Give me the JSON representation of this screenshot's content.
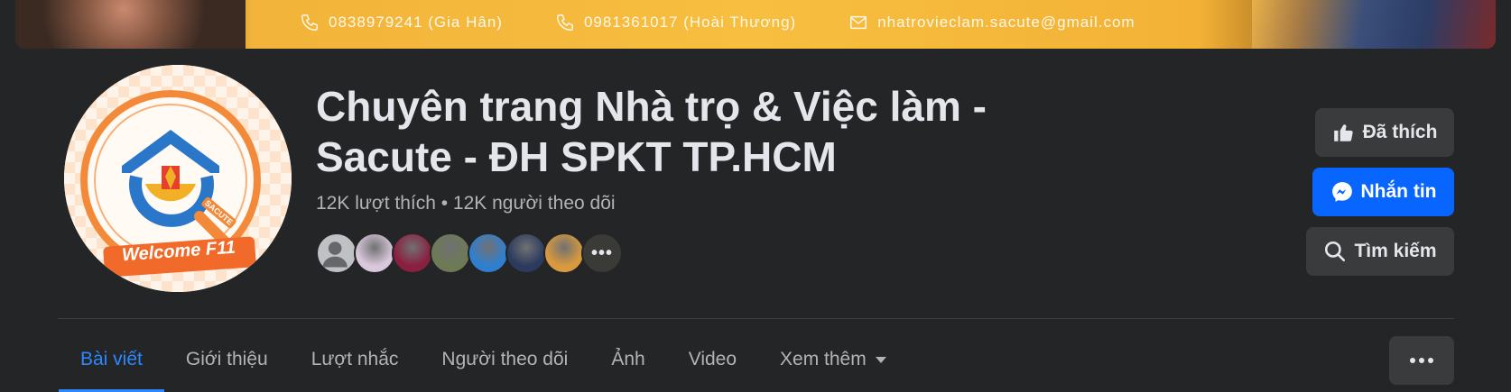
{
  "cover": {
    "contacts": [
      {
        "icon": "phone-icon",
        "text": "0838979241 (Gia Hân)"
      },
      {
        "icon": "phone-icon",
        "text": "0981361017 (Hoài Thương)"
      },
      {
        "icon": "mail-icon",
        "text": "nhatrovieclam.sacute@gmail.com"
      }
    ]
  },
  "avatar": {
    "logo_text": "Welcome F11",
    "badge_text": "SACUTE"
  },
  "page": {
    "title_line1": "Chuyên trang Nhà trọ & Việc làm -",
    "title_line2": "Sacute - ĐH SPKT TP.HCM",
    "likes": "12K lượt thích",
    "separator": " • ",
    "followers": "12K người theo dõi"
  },
  "faces": {
    "more_label": "•••",
    "colors": [
      "#bfc1c4",
      "#d9c8dc",
      "#8a1f3f",
      "#6d7a55",
      "#2f7fd1",
      "#2b3a5e",
      "#d99a3d",
      "#3a3b36"
    ]
  },
  "actions": {
    "liked": "Đã thích",
    "message": "Nhắn tin",
    "search": "Tìm kiếm"
  },
  "tabs": [
    {
      "label": "Bài viết",
      "active": true
    },
    {
      "label": "Giới thiệu"
    },
    {
      "label": "Lượt nhắc"
    },
    {
      "label": "Người theo dõi"
    },
    {
      "label": "Ảnh"
    },
    {
      "label": "Video"
    },
    {
      "label": "Xem thêm",
      "caret": true
    }
  ],
  "colors": {
    "background": "#242526",
    "accent": "#0866ff",
    "active_tab": "#2d88ff"
  }
}
